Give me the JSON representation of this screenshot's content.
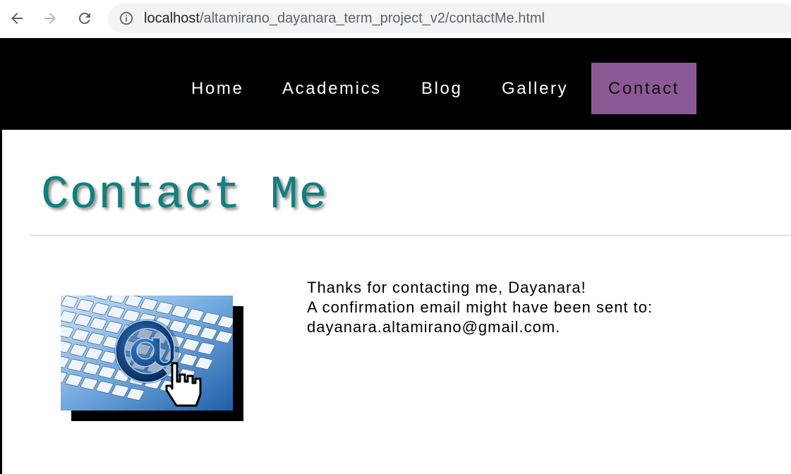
{
  "browser": {
    "url_host": "localhost",
    "url_path": "/altamirano_dayanara_term_project_v2/contactMe.html",
    "icons": [
      "back-arrow-icon",
      "forward-arrow-icon",
      "reload-icon",
      "info-icon"
    ]
  },
  "nav": {
    "items": [
      {
        "label": "Home"
      },
      {
        "label": "Academics"
      },
      {
        "label": "Blog"
      },
      {
        "label": "Gallery"
      },
      {
        "label": "Contact"
      }
    ],
    "active_color": "#8b5a96"
  },
  "main": {
    "title": "Contact Me",
    "title_color": "#137e7e",
    "message": {
      "line1": "Thanks for contacting me, Dayanara!",
      "line2": "A confirmation email might have been sent to:",
      "email": "dayanara.altamirano@gmail.com",
      "email_suffix": "."
    }
  }
}
